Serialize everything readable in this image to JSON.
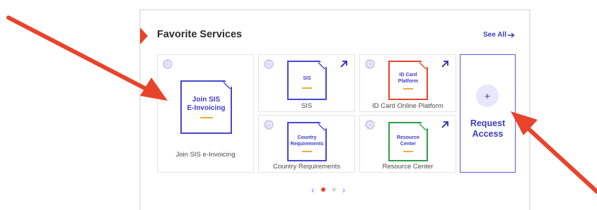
{
  "section": {
    "title": "Favorite Services",
    "see_all_label": "See All",
    "see_all_icon": "arrow-right-icon"
  },
  "cards": [
    {
      "name": "join-sis-einvoicing",
      "doc_label_line1": "Join SIS",
      "doc_label_line2": "E-Invoicing",
      "caption": "Join SIS e-Invoicing",
      "doc_color": "#4747d1",
      "external_link": false
    },
    {
      "name": "sis",
      "doc_label_line1": "SIS",
      "doc_label_line2": "",
      "caption": "SIS",
      "doc_color": "#4747d1",
      "external_link": true
    },
    {
      "name": "id-card-online-platform",
      "doc_label_line1": "ID Card",
      "doc_label_line2": "Platform",
      "caption": "ID Card Online Platform",
      "doc_color": "#e8432b",
      "external_link": true
    },
    {
      "name": "country-requirements",
      "doc_label_line1": "Country",
      "doc_label_line2": "Requirements",
      "caption": "Country Requirements",
      "doc_color": "#4747d1",
      "external_link": false
    },
    {
      "name": "resource-center",
      "doc_label_line1": "Resource",
      "doc_label_line2": "Center",
      "caption": "Resource Center",
      "doc_color": "#2e9e4a",
      "external_link": true
    }
  ],
  "request_access": {
    "plus": "+",
    "label_line1": "Request",
    "label_line2": "Access"
  },
  "pager": {
    "prev": "‹",
    "next": "›",
    "active_page": 1,
    "total_pages": 2,
    "active_color": "#e8432b",
    "inactive_color": "#d9d9d9"
  },
  "annotation_color": "#e8432b"
}
